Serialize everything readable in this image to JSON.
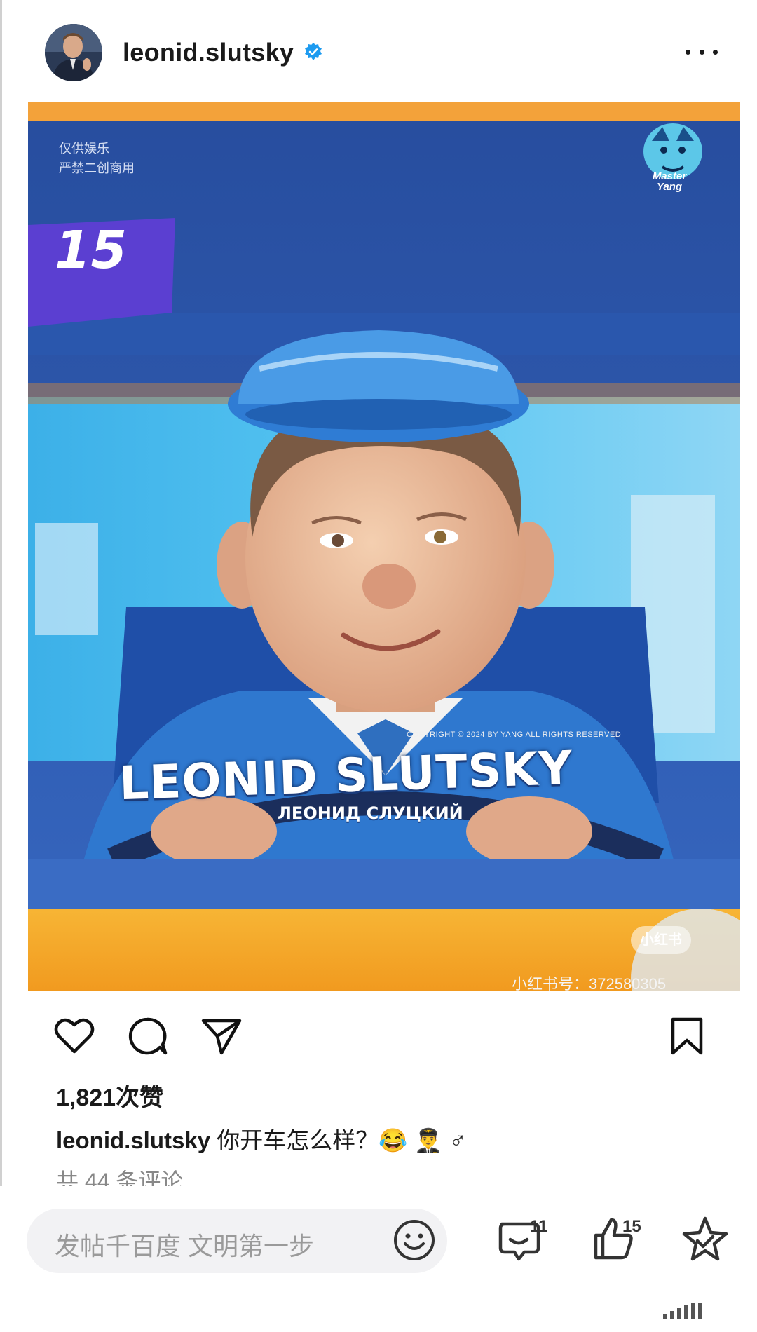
{
  "header": {
    "username": "leonid.slutsky",
    "verified_icon": "verified-badge-icon",
    "more_icon": "more-options-icon"
  },
  "post_image": {
    "disclaimer_line1": "仅供娱乐",
    "disclaimer_line2": "严禁二创商用",
    "number_badge": "15",
    "logo_text_line1": "Master",
    "logo_text_line2": "Yang",
    "copyright": "COPYRIGHT © 2024 BY YANG ALL RIGHTS RESERVED",
    "name_latin": "LEONID SLUTSKY",
    "name_cyrillic": "ЛЕОНИД СЛУЦКИЙ",
    "xhs_badge": "小红书",
    "xhs_id": "小红书号：372580305"
  },
  "actions": {
    "like_icon": "heart-icon",
    "comment_icon": "comment-bubble-icon",
    "share_icon": "send-icon",
    "save_icon": "bookmark-icon"
  },
  "post_meta": {
    "likes": "1,821次赞",
    "caption_user": "leonid.slutsky",
    "caption_text": "你开车怎么样？😂 👨‍✈️ ♂",
    "comments_link": "共 44 条评论"
  },
  "bottom_bar": {
    "input_placeholder": "发帖千百度 文明第一步",
    "emoji_icon": "smiley-icon",
    "comment_count": "11",
    "like_count": "15",
    "favorite_icon": "star-icon"
  },
  "colors": {
    "post_background": "#1e5fb0",
    "accent_orange": "#f5a623",
    "verified_blue": "#1d9bf0"
  }
}
